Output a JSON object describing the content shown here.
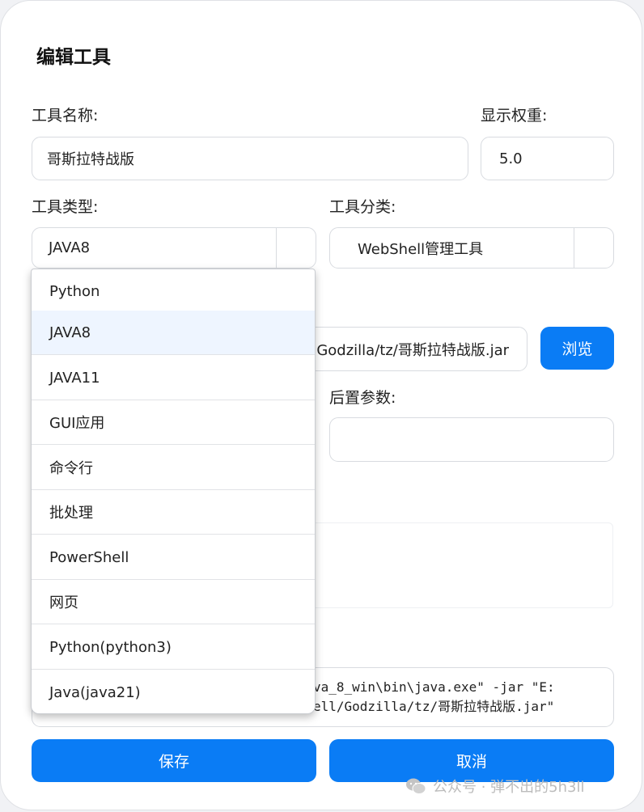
{
  "dialog": {
    "title": "编辑工具",
    "name_label": "工具名称:",
    "name_value": "哥斯拉特战版",
    "weight_label": "显示权重:",
    "weight_value": "5.0",
    "type_label": "工具类型:",
    "type_value": "JAVA8",
    "category_label": "工具分类:",
    "category_value": "WebShell管理工具",
    "path_value_visible": "Godzilla/tz/哥斯拉特战版.jar",
    "browse_label": "浏览",
    "post_params_label": "后置参数:",
    "post_params_value": "",
    "command_line1": "va_8_win\\bin\\java.exe\" -jar \"E:",
    "command_line2": "ell/Godzilla/tz/哥斯拉特战版.jar\"",
    "save_label": "保存",
    "cancel_label": "取消"
  },
  "dropdown": {
    "selected": "JAVA8",
    "options": [
      "Python",
      "JAVA8",
      "JAVA11",
      "GUI应用",
      "命令行",
      "批处理",
      "PowerShell",
      "网页",
      "Python(python3)",
      "Java(java21)"
    ]
  },
  "watermark": {
    "text": "公众号 · 弹不出的5h3ll",
    "icon": "wechat-icon"
  },
  "colors": {
    "accent": "#0a7cf5",
    "selected_option_bg": "#eef5ff"
  }
}
